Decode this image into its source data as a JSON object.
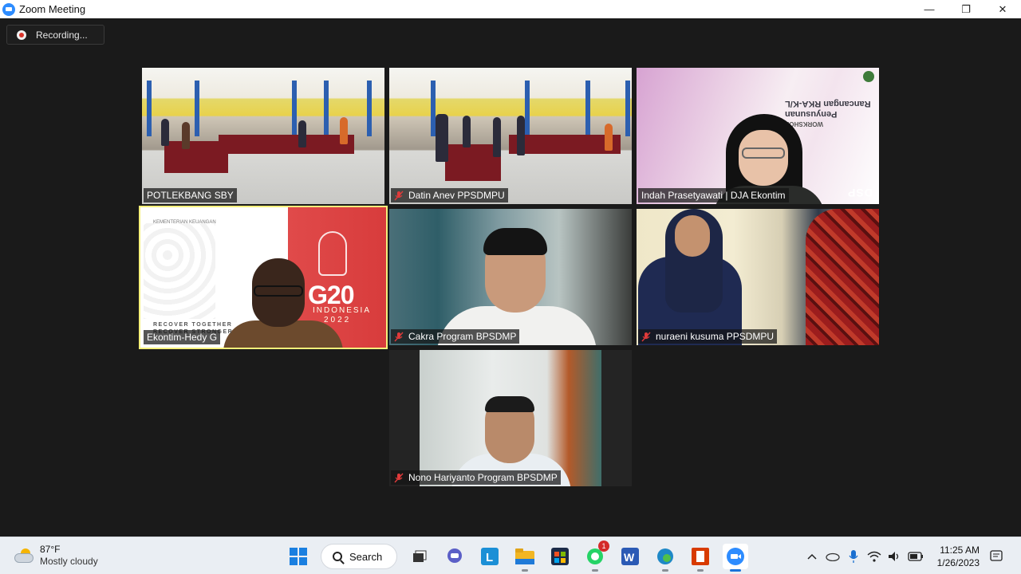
{
  "window": {
    "title": "Zoom Meeting",
    "minimize_glyph": "—",
    "maximize_glyph": "❐",
    "close_glyph": "✕"
  },
  "meeting": {
    "recording_label": "Recording...",
    "tiles": [
      {
        "name": "POTLEKBANG SBY",
        "muted": false,
        "scene": "hall"
      },
      {
        "name": "Datin Anev PPSDMPU",
        "muted": true,
        "scene": "hall"
      },
      {
        "name": "Indah Prasetyawati | DJA Ekontim",
        "muted": false,
        "scene": "workshop"
      },
      {
        "name": "Ekontim-Hedy G",
        "muted": false,
        "scene": "g20",
        "active_speaker": true
      },
      {
        "name": "Cakra Program BPSDMP",
        "muted": true,
        "scene": "office"
      },
      {
        "name": "nuraeni kusuma PPSDMPU",
        "muted": true,
        "scene": "room"
      },
      {
        "name": "Nono Hariyanto Program BPSDMP",
        "muted": true,
        "scene": "office2"
      }
    ],
    "workshop_background": {
      "line1": "WORKSHOP",
      "line2": "Penyusunan",
      "line3": "Rancangan RKA-K/L",
      "brand": "DSP"
    },
    "g20_background": {
      "logo": "G20",
      "country": "INDONESIA",
      "year": "2022",
      "slogan_1": "RECOVER TOGETHER",
      "slogan_2": "RECOVER STRONGER",
      "org": "KEMENTERIAN KEUANGAN"
    }
  },
  "taskbar": {
    "weather": {
      "temp": "87°F",
      "condition": "Mostly cloudy"
    },
    "search_label": "Search",
    "whatsapp_badge": "1",
    "apps": [
      "start-icon",
      "task-view-icon",
      "teams-chat-icon",
      "l-app-icon",
      "file-explorer-icon",
      "store-icon",
      "whatsapp-icon",
      "word-icon",
      "edge-icon",
      "office-icon",
      "zoom-icon"
    ],
    "clock": {
      "time": "11:25 AM",
      "date": "1/26/2023"
    },
    "colors": {
      "accent": "#1a73d9",
      "zoom_blue": "#2d8cff",
      "active_speaker": "#f5f07a"
    }
  }
}
